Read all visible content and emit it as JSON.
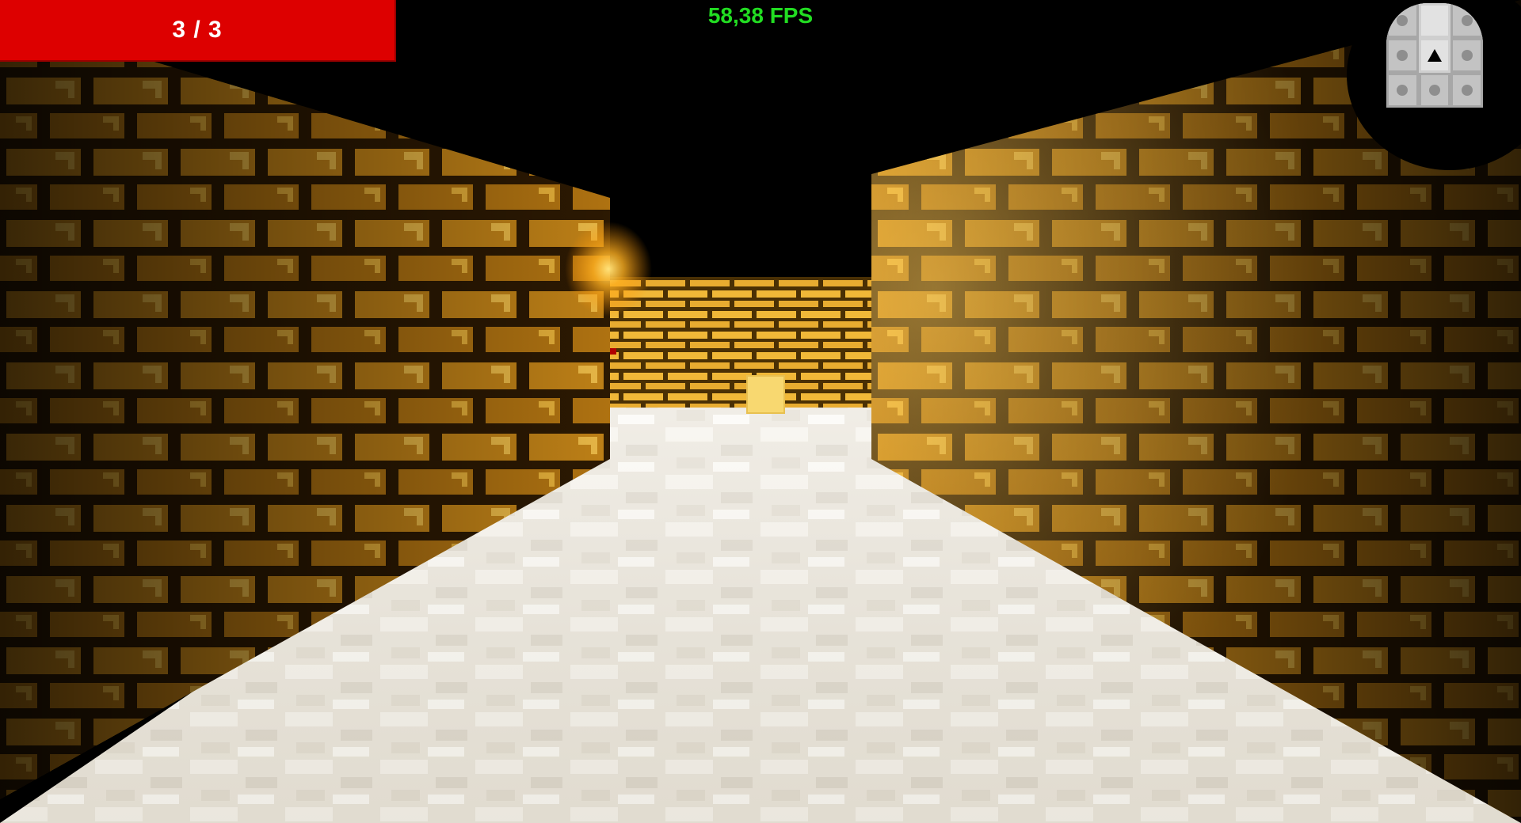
{
  "hud": {
    "health_text": "3 / 3",
    "fps_text": "58,38 FPS"
  },
  "colors": {
    "health_bar": "#dd0000",
    "fps_text": "#22dd22",
    "brick": "#e0a020",
    "mortar": "#2a1800",
    "floor": "#e8e2d6"
  },
  "minimap": {
    "rows": 3,
    "cols": 3,
    "player_cell": [
      1,
      2
    ],
    "player_icon": "triangle-up-icon"
  }
}
